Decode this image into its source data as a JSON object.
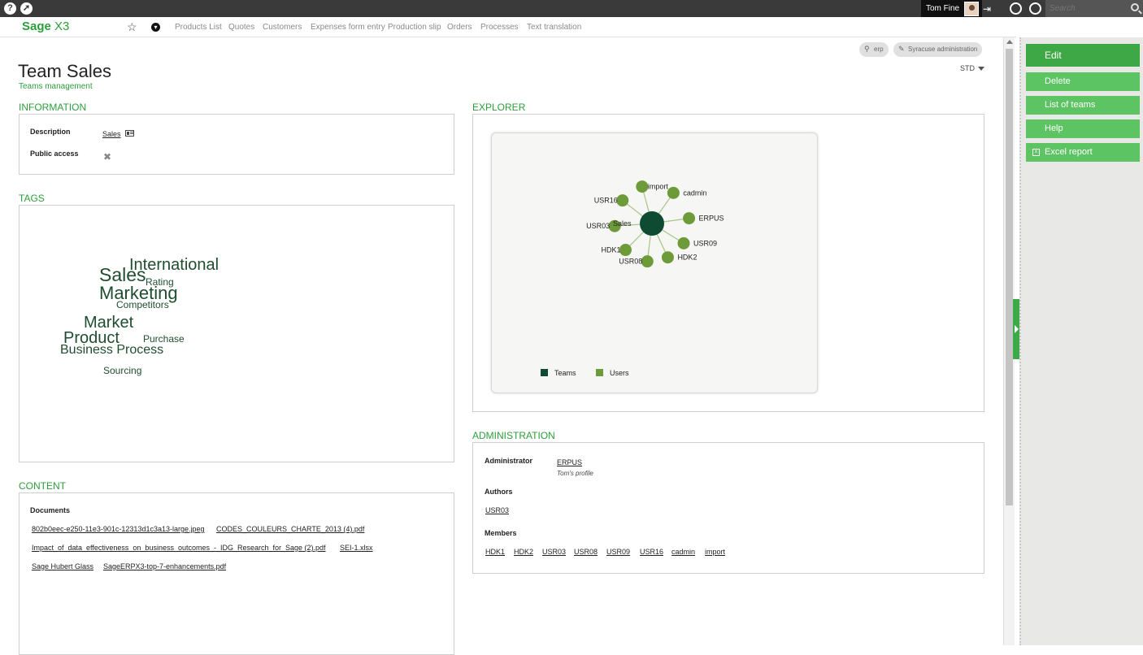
{
  "topbar": {
    "help_icon": "?",
    "user_name": "Tom Fine",
    "search_placeholder": "Search"
  },
  "menubar": {
    "brand": "Sage",
    "brand_suffix": "X3",
    "items": [
      "Products List",
      "Quotes",
      "Customers",
      "Expenses form entry",
      "Production slip",
      "Orders",
      "Processes",
      "Text translation"
    ]
  },
  "header": {
    "title": "Team Sales",
    "subtitle": "Teams management",
    "pills": [
      "erp",
      "Syracuse administration"
    ],
    "layout_selector": "STD"
  },
  "information": {
    "title": "INFORMATION",
    "description_label": "Description",
    "description_value": "Sales",
    "public_access_label": "Public access",
    "public_access_value": "✖"
  },
  "tags": {
    "title": "TAGS",
    "items": [
      "International",
      "Sales",
      "Rating",
      "Marketing",
      "Competitors",
      "Market",
      "Product",
      "Purchase",
      "Business Process",
      "Sourcing"
    ]
  },
  "content_section": {
    "title": "CONTENT",
    "documents_label": "Documents",
    "documents": [
      "802b0eec-e250-11e3-901c-12313d1c3a13-large.jpeg",
      "CODES_COULEURS_CHARTE_2013 (4).pdf",
      "Impact_of_data_effectiveness_on_business_outcomes_-_IDG_Research_for_Sage (2).pdf",
      "SEI-1.xlsx",
      "Sage Hubert Glass",
      "SageERPX3-top-7-enhancements.pdf"
    ]
  },
  "explorer": {
    "title": "EXPLORER",
    "center_label": "Sales",
    "nodes": [
      "import",
      "cadmin",
      "ERPUS",
      "USR09",
      "HDK2",
      "USR08",
      "HDK1",
      "USR03",
      "USR16"
    ],
    "legend": [
      "Teams",
      "Users"
    ],
    "colors": {
      "team": "#0f4a33",
      "user": "#6e9b3a",
      "edge": "#a8c48a"
    }
  },
  "administration": {
    "title": "ADMINISTRATION",
    "administrator_label": "Administrator",
    "administrator_value": "ERPUS",
    "administrator_note": "Tom's profile",
    "authors_label": "Authors",
    "authors": [
      "USR03"
    ],
    "members_label": "Members",
    "members": [
      "HDK1",
      "HDK2",
      "USR03",
      "USR08",
      "USR09",
      "USR16",
      "cadmin",
      "import"
    ]
  },
  "actions": {
    "items": [
      "Edit",
      "Delete",
      "List of teams",
      "Help",
      "Excel report"
    ]
  },
  "theme": {
    "accent": "#2c9e3b",
    "button": "#5cc463",
    "button_active": "#3fa846"
  }
}
